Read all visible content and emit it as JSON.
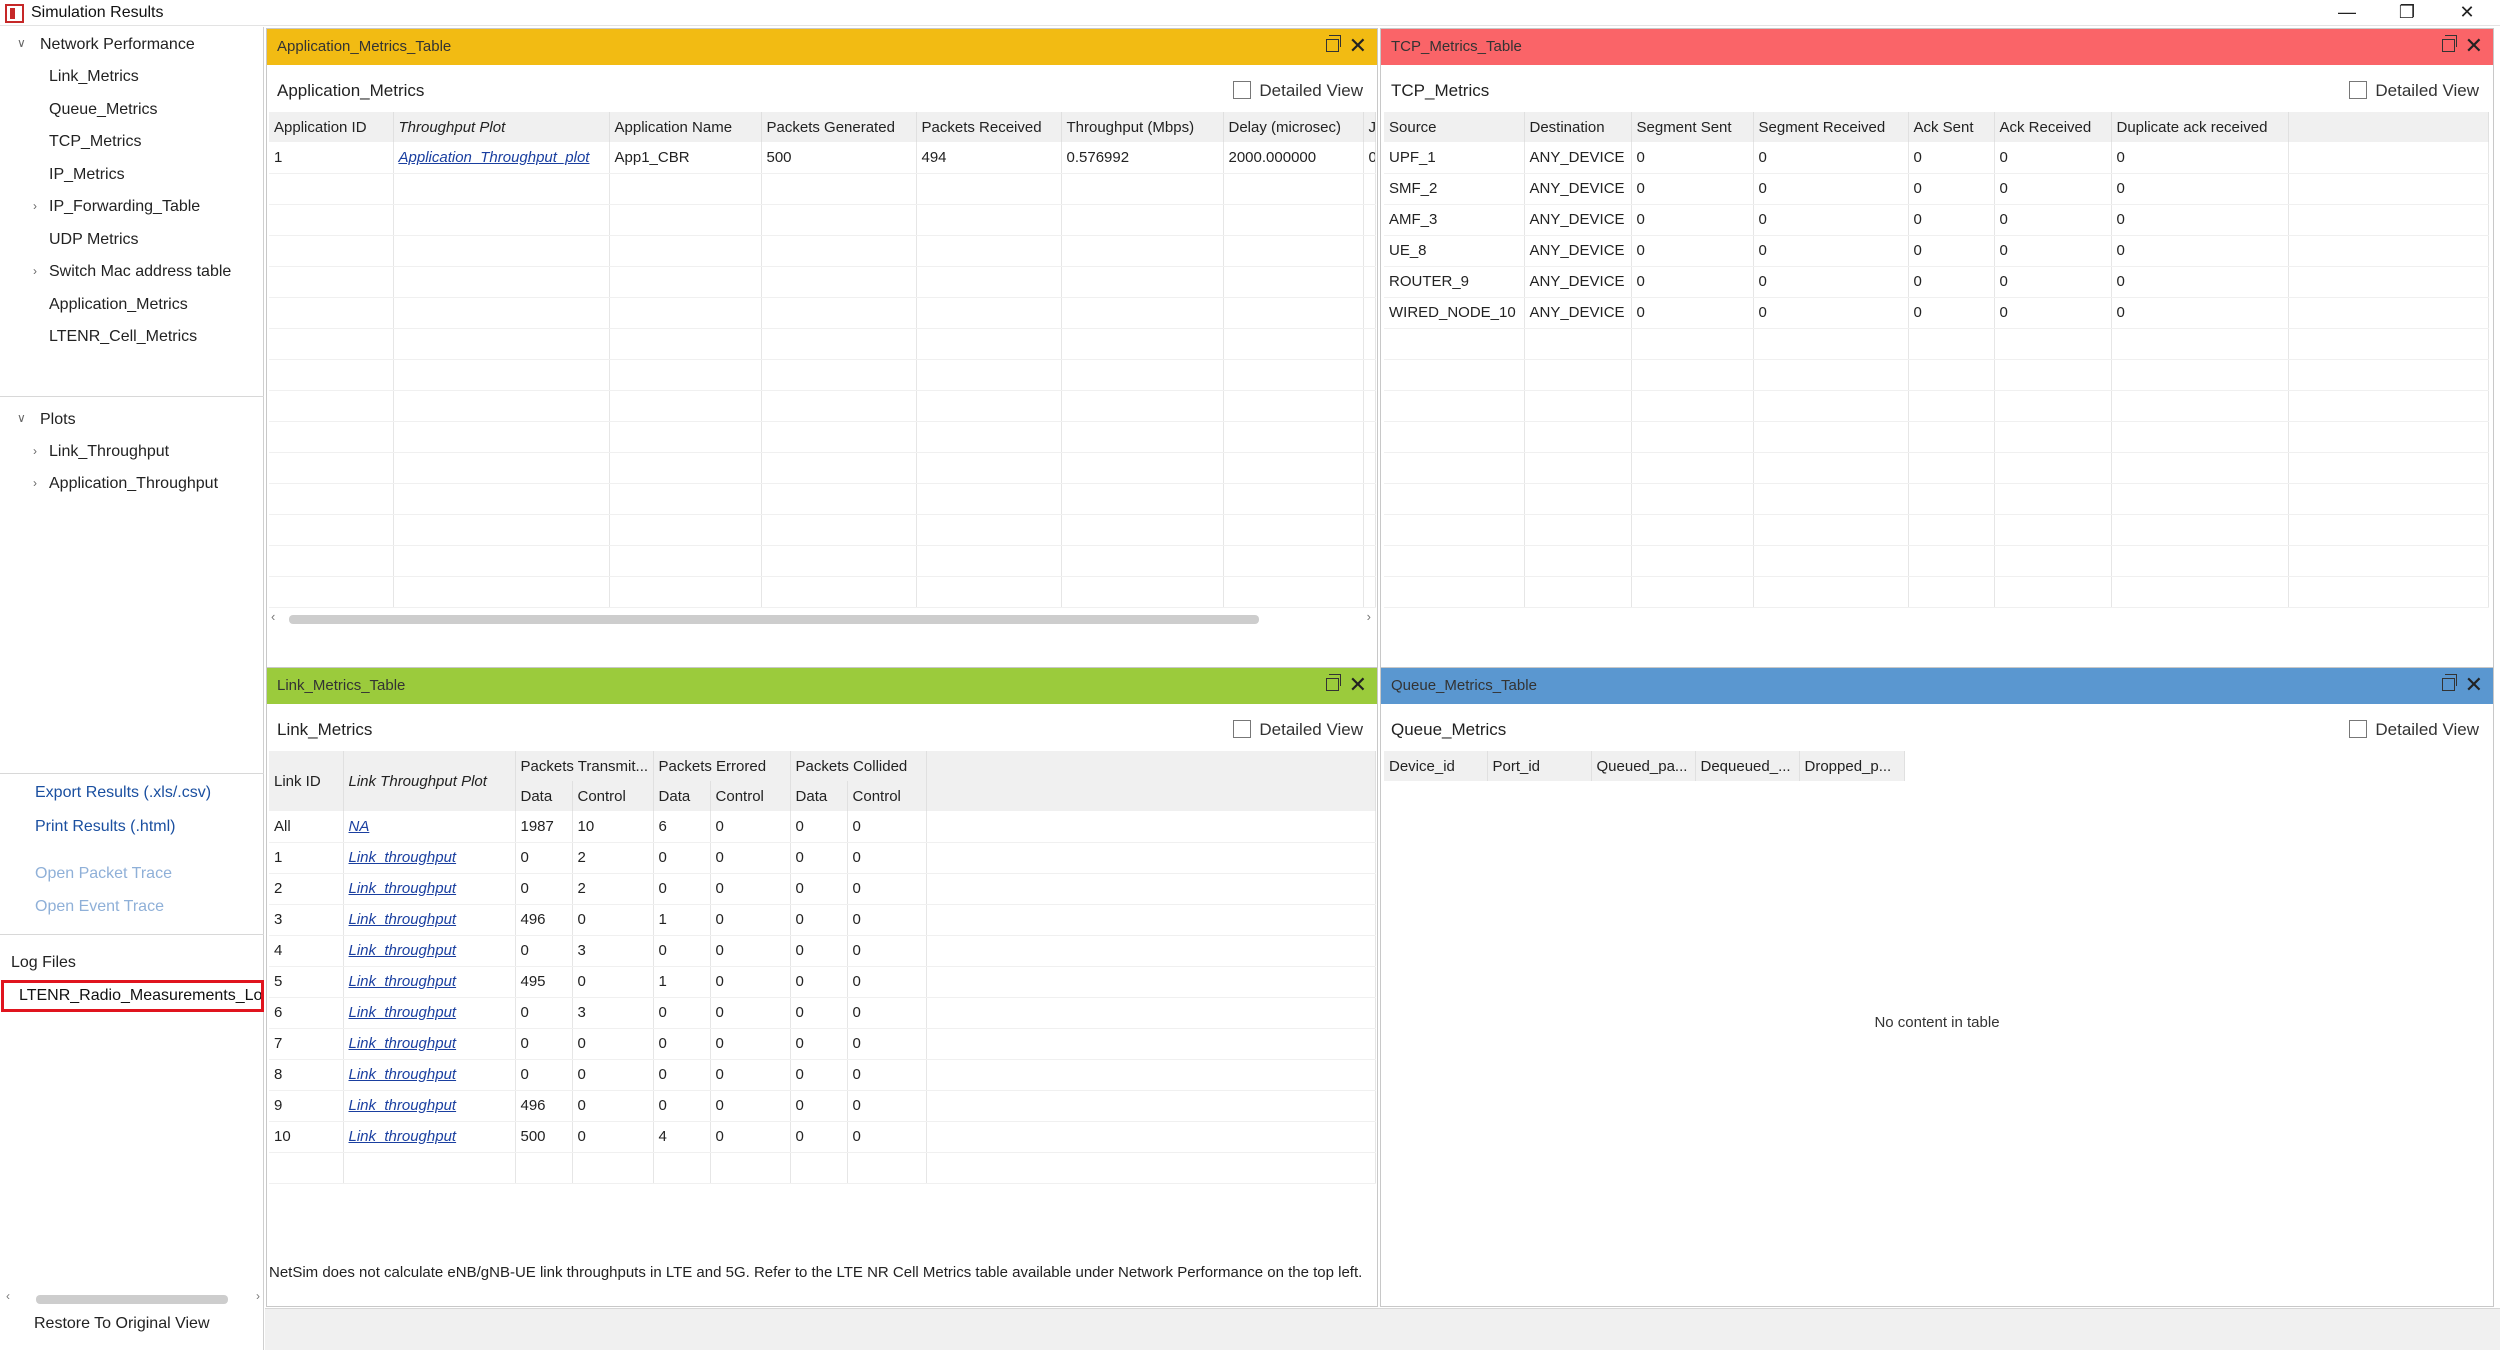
{
  "window": {
    "title": "Simulation Results",
    "minimize": "—",
    "restore": "❐",
    "close": "✕"
  },
  "sidebar": {
    "network_performance": "Network Performance",
    "items": [
      "Link_Metrics",
      "Queue_Metrics",
      "TCP_Metrics",
      "IP_Metrics",
      "IP_Forwarding_Table",
      "UDP Metrics",
      "Switch Mac address table",
      "Application_Metrics",
      "LTENR_Cell_Metrics"
    ],
    "plots": "Plots",
    "plot_items": [
      "Link_Throughput",
      "Application_Throughput"
    ],
    "export": "Export Results (.xls/.csv)",
    "print": "Print Results (.html)",
    "open_packet_trace": "Open Packet Trace",
    "open_event_trace": "Open Event Trace",
    "log_files": "Log Files",
    "log_file_item": "LTENR_Radio_Measurements_Log",
    "restore": "Restore To Original View"
  },
  "colors": {
    "app_header": "#f2bb13",
    "tcp_header": "#fa6468",
    "link_header": "#9bcb3c",
    "queue_header": "#5a97d0",
    "log_highlight": "#e0141e"
  },
  "app_panel": {
    "title": "Application_Metrics_Table",
    "subtitle": "Application_Metrics",
    "detailed_view": "Detailed View",
    "columns": [
      "Application ID",
      "Throughput Plot",
      "Application Name",
      "Packets Generated",
      "Packets Received",
      "Throughput (Mbps)",
      "Delay (microsec)",
      "Ji"
    ],
    "rows": [
      [
        "1",
        "Application_Throughput_plot",
        "App1_CBR",
        "500",
        "494",
        "0.576992",
        "2000.000000",
        "0"
      ]
    ]
  },
  "tcp_panel": {
    "title": "TCP_Metrics_Table",
    "subtitle": "TCP_Metrics",
    "detailed_view": "Detailed View",
    "columns": [
      "Source",
      "Destination",
      "Segment Sent",
      "Segment Received",
      "Ack Sent",
      "Ack Received",
      "Duplicate ack received"
    ],
    "rows": [
      [
        "UPF_1",
        "ANY_DEVICE",
        "0",
        "0",
        "0",
        "0",
        "0"
      ],
      [
        "SMF_2",
        "ANY_DEVICE",
        "0",
        "0",
        "0",
        "0",
        "0"
      ],
      [
        "AMF_3",
        "ANY_DEVICE",
        "0",
        "0",
        "0",
        "0",
        "0"
      ],
      [
        "UE_8",
        "ANY_DEVICE",
        "0",
        "0",
        "0",
        "0",
        "0"
      ],
      [
        "ROUTER_9",
        "ANY_DEVICE",
        "0",
        "0",
        "0",
        "0",
        "0"
      ],
      [
        "WIRED_NODE_10",
        "ANY_DEVICE",
        "0",
        "0",
        "0",
        "0",
        "0"
      ]
    ]
  },
  "link_panel": {
    "title": "Link_Metrics_Table",
    "subtitle": "Link_Metrics",
    "detailed_view": "Detailed View",
    "col_link_id": "Link ID",
    "col_plot": "Link Throughput Plot",
    "groups": [
      "Packets Transmit...",
      "Packets Errored",
      "Packets Collided"
    ],
    "sub_data": "Data",
    "sub_control": "Control",
    "rows": [
      [
        "All",
        "NA",
        "1987",
        "10",
        "6",
        "0",
        "0",
        "0"
      ],
      [
        "1",
        "Link_throughput",
        "0",
        "2",
        "0",
        "0",
        "0",
        "0"
      ],
      [
        "2",
        "Link_throughput",
        "0",
        "2",
        "0",
        "0",
        "0",
        "0"
      ],
      [
        "3",
        "Link_throughput",
        "496",
        "0",
        "1",
        "0",
        "0",
        "0"
      ],
      [
        "4",
        "Link_throughput",
        "0",
        "3",
        "0",
        "0",
        "0",
        "0"
      ],
      [
        "5",
        "Link_throughput",
        "495",
        "0",
        "1",
        "0",
        "0",
        "0"
      ],
      [
        "6",
        "Link_throughput",
        "0",
        "3",
        "0",
        "0",
        "0",
        "0"
      ],
      [
        "7",
        "Link_throughput",
        "0",
        "0",
        "0",
        "0",
        "0",
        "0"
      ],
      [
        "8",
        "Link_throughput",
        "0",
        "0",
        "0",
        "0",
        "0",
        "0"
      ],
      [
        "9",
        "Link_throughput",
        "496",
        "0",
        "0",
        "0",
        "0",
        "0"
      ],
      [
        "10",
        "Link_throughput",
        "500",
        "0",
        "4",
        "0",
        "0",
        "0"
      ]
    ],
    "note": "NetSim does not calculate eNB/gNB-UE link throughputs in LTE and 5G. Refer to the LTE NR Cell Metrics table available under Network Performance on the top left."
  },
  "queue_panel": {
    "title": "Queue_Metrics_Table",
    "subtitle": "Queue_Metrics",
    "detailed_view": "Detailed View",
    "columns": [
      "Device_id",
      "Port_id",
      "Queued_pa...",
      "Dequeued_...",
      "Dropped_p..."
    ],
    "empty_message": "No content in table"
  }
}
